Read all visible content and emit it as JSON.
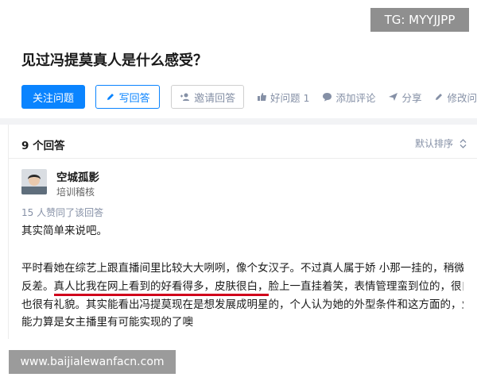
{
  "watermark_top": "TG: MYYJJPP",
  "question": {
    "title": "见过冯提莫真人是什么感受？"
  },
  "actions": {
    "follow": "关注问题",
    "write": "写回答",
    "invite": "邀请回答",
    "good_question": "好问题 1",
    "comment": "添加评论",
    "share": "分享",
    "edit": "修改问"
  },
  "answers": {
    "count_label": "9 个回答",
    "sort_label": "默认排序"
  },
  "answer": {
    "author_name": "空城孤影",
    "author_tag": "培训稽核",
    "upvote_text": "15 人赞同了该回答",
    "para1": "其实简单来说吧。",
    "line1": "平时看她在综艺上跟直播间里比较大大咧咧，像个女汉子。不过真人属于娇 小那一挂的，稍微有点",
    "line2_a": "反差。",
    "line2_hl": "真人比我在网上看到的好看得多，皮肤很白，",
    "line2_b": "脸上一直挂着笑，表情管理蛮到位的，很自信",
    "line3": "也很有礼貌。其实能看出冯提莫现在是想发展成明星的，个人认为她的外型条件和这方面的，业 务",
    "line4": "能力算是女主播里有可能实现的了噢"
  },
  "watermark_bottom": "www.baijialewanfacn.com",
  "colors": {
    "primary": "#0a84ff",
    "muted": "#8590a6",
    "highlight_underline": "#d0021b"
  }
}
